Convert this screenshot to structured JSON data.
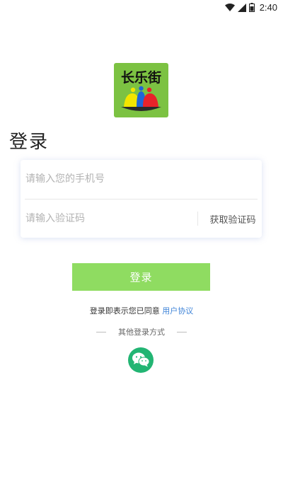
{
  "status_bar": {
    "time": "2:40",
    "wifi_icon": "wifi-icon",
    "signal_icon": "cell-signal-icon",
    "battery_icon": "battery-icon"
  },
  "logo": {
    "text": "长乐街",
    "background_color": "#7cc242"
  },
  "page": {
    "title": "登录"
  },
  "form": {
    "phone_placeholder": "请输入您的手机号",
    "phone_value": "",
    "code_placeholder": "请输入验证码",
    "code_value": "",
    "get_code_label": "获取验证码"
  },
  "login_button": {
    "label": "登录",
    "color": "#8fdc61"
  },
  "agreement": {
    "prefix": "登录即表示您已同意",
    "link_text": "用户协议",
    "link_color": "#3f84d8"
  },
  "other_login": {
    "label": "其他登录方式",
    "wechat_icon": "wechat-icon",
    "wechat_color": "#22b573"
  }
}
